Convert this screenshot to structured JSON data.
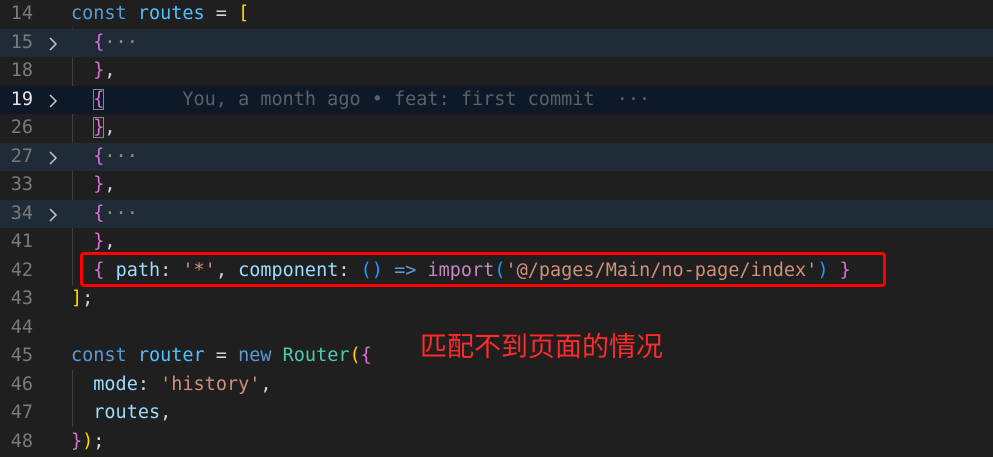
{
  "editor": {
    "lines": [
      {
        "number": "14",
        "folded": false,
        "current": false,
        "tokens": [
          {
            "c": "kw",
            "t": "const"
          },
          {
            "c": "plain",
            "t": " "
          },
          {
            "c": "var",
            "t": "routes"
          },
          {
            "c": "plain",
            "t": " = "
          },
          {
            "c": "b1",
            "t": "["
          }
        ]
      },
      {
        "number": "15",
        "folded": true,
        "current": false,
        "tokens": [
          {
            "c": "plain",
            "t": "  "
          },
          {
            "c": "b2",
            "t": "{"
          },
          {
            "c": "ellipsis",
            "t": "···"
          }
        ]
      },
      {
        "number": "18",
        "folded": false,
        "current": false,
        "tokens": [
          {
            "c": "plain",
            "t": "  "
          },
          {
            "c": "b2",
            "t": "}"
          },
          {
            "c": "plain",
            "t": ","
          }
        ]
      },
      {
        "number": "19",
        "folded": true,
        "current": true,
        "tokens": [
          {
            "c": "plain",
            "t": "  "
          },
          {
            "c": "b2 matched",
            "t": "{"
          },
          {
            "c": "plain",
            "t": "       "
          },
          {
            "c": "blame",
            "t": "You, a month ago • feat: first commit  ···"
          }
        ]
      },
      {
        "number": "26",
        "folded": false,
        "current": false,
        "tokens": [
          {
            "c": "plain",
            "t": "  "
          },
          {
            "c": "b2 matched",
            "t": "}"
          },
          {
            "c": "plain",
            "t": ","
          }
        ]
      },
      {
        "number": "27",
        "folded": true,
        "current": false,
        "tokens": [
          {
            "c": "plain",
            "t": "  "
          },
          {
            "c": "b2",
            "t": "{"
          },
          {
            "c": "ellipsis",
            "t": "···"
          }
        ]
      },
      {
        "number": "33",
        "folded": false,
        "current": false,
        "tokens": [
          {
            "c": "plain",
            "t": "  "
          },
          {
            "c": "b2",
            "t": "}"
          },
          {
            "c": "plain",
            "t": ","
          }
        ]
      },
      {
        "number": "34",
        "folded": true,
        "current": false,
        "tokens": [
          {
            "c": "plain",
            "t": "  "
          },
          {
            "c": "b2",
            "t": "{"
          },
          {
            "c": "ellipsis",
            "t": "···"
          }
        ]
      },
      {
        "number": "41",
        "folded": false,
        "current": false,
        "tokens": [
          {
            "c": "plain",
            "t": "  "
          },
          {
            "c": "b2",
            "t": "}"
          },
          {
            "c": "plain",
            "t": ","
          }
        ]
      },
      {
        "number": "42",
        "folded": false,
        "current": false,
        "tokens": [
          {
            "c": "plain",
            "t": "  "
          },
          {
            "c": "b2",
            "t": "{"
          },
          {
            "c": "plain",
            "t": " "
          },
          {
            "c": "id",
            "t": "path"
          },
          {
            "c": "plain",
            "t": ": "
          },
          {
            "c": "str",
            "t": "'*'"
          },
          {
            "c": "plain",
            "t": ", "
          },
          {
            "c": "id",
            "t": "component"
          },
          {
            "c": "plain",
            "t": ": "
          },
          {
            "c": "b3",
            "t": "()"
          },
          {
            "c": "plain",
            "t": " "
          },
          {
            "c": "kw",
            "t": "=>"
          },
          {
            "c": "plain",
            "t": " "
          },
          {
            "c": "ctl",
            "t": "import"
          },
          {
            "c": "b3",
            "t": "("
          },
          {
            "c": "str",
            "t": "'@/pages/Main/no-page/index'"
          },
          {
            "c": "b3",
            "t": ")"
          },
          {
            "c": "plain",
            "t": " "
          },
          {
            "c": "b2",
            "t": "}"
          }
        ]
      },
      {
        "number": "43",
        "folded": false,
        "current": false,
        "tokens": [
          {
            "c": "b1",
            "t": "]"
          },
          {
            "c": "plain",
            "t": ";"
          }
        ]
      },
      {
        "number": "44",
        "folded": false,
        "current": false,
        "tokens": []
      },
      {
        "number": "45",
        "folded": false,
        "current": false,
        "tokens": [
          {
            "c": "kw",
            "t": "const"
          },
          {
            "c": "plain",
            "t": " "
          },
          {
            "c": "var",
            "t": "router"
          },
          {
            "c": "plain",
            "t": " = "
          },
          {
            "c": "kw",
            "t": "new"
          },
          {
            "c": "plain",
            "t": " "
          },
          {
            "c": "cls",
            "t": "Router"
          },
          {
            "c": "b1",
            "t": "("
          },
          {
            "c": "b2",
            "t": "{"
          }
        ]
      },
      {
        "number": "46",
        "folded": false,
        "current": false,
        "tokens": [
          {
            "c": "plain",
            "t": "  "
          },
          {
            "c": "id",
            "t": "mode"
          },
          {
            "c": "plain",
            "t": ": "
          },
          {
            "c": "str",
            "t": "'history'"
          },
          {
            "c": "plain",
            "t": ","
          }
        ]
      },
      {
        "number": "47",
        "folded": false,
        "current": false,
        "tokens": [
          {
            "c": "plain",
            "t": "  "
          },
          {
            "c": "id",
            "t": "routes"
          },
          {
            "c": "plain",
            "t": ","
          }
        ]
      },
      {
        "number": "48",
        "folded": false,
        "current": false,
        "tokens": [
          {
            "c": "b2",
            "t": "}"
          },
          {
            "c": "b1",
            "t": ")"
          },
          {
            "c": "plain",
            "t": ";"
          }
        ]
      }
    ]
  },
  "annotation": {
    "text": "匹配不到页面的情况",
    "color": "#ff0000"
  },
  "icons": {
    "fold": "chevron-right-icon"
  }
}
